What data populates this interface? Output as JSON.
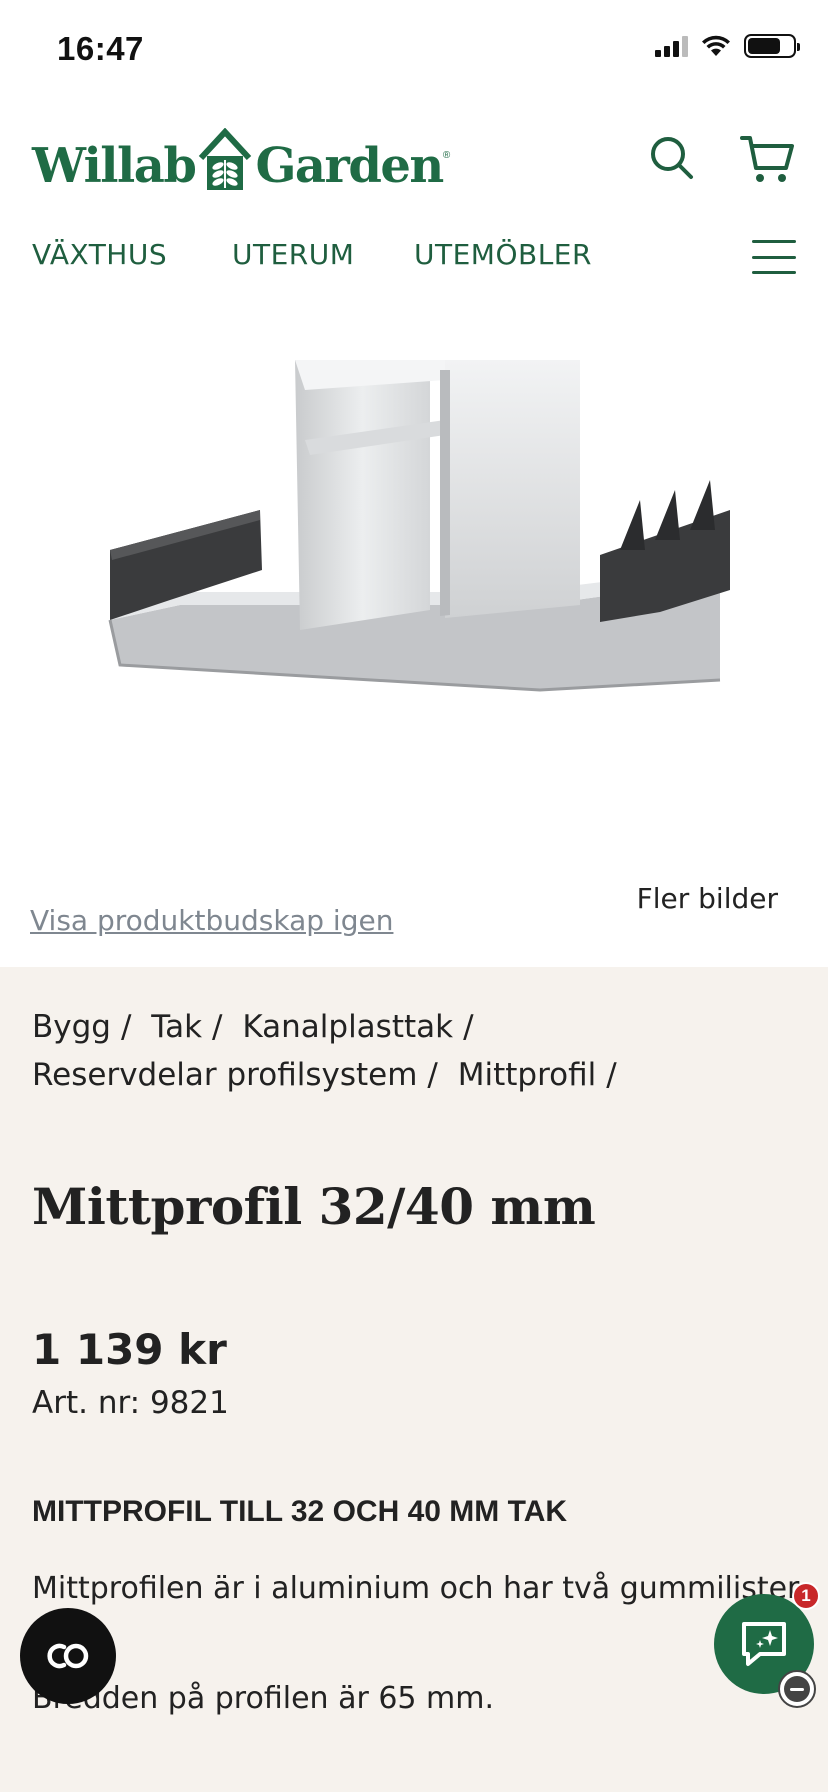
{
  "status_bar": {
    "time": "16:47",
    "icons": [
      "cellular-signal-icon",
      "wifi-icon",
      "battery-icon"
    ]
  },
  "header": {
    "logo": {
      "part1": "Willab",
      "part2": "Garden",
      "reg": "®"
    },
    "icons": [
      "search-icon",
      "cart-icon"
    ]
  },
  "nav": {
    "items": [
      {
        "label": "VÄXTHUS"
      },
      {
        "label": "UTERUM"
      },
      {
        "label": "UTEMÖBLER"
      }
    ],
    "menu_icon": "hamburger-menu-icon"
  },
  "gallery": {
    "more_images_label": "Fler bilder",
    "show_message_link": "Visa produktbudskap igen"
  },
  "breadcrumb": {
    "items": [
      {
        "label": "Bygg"
      },
      {
        "label": "Tak"
      },
      {
        "label": "Kanalplasttak"
      },
      {
        "label": "Reservdelar profilsystem"
      },
      {
        "label": "Mittprofil"
      }
    ],
    "separator": "/"
  },
  "product": {
    "title": "Mittprofil 32/40 mm",
    "price": "1 139 kr",
    "article_number": "Art. nr: 9821",
    "description_heading": "MITTPROFIL TILL 32 OCH 40 MM TAK",
    "description_p1": "Mittprofilen är i aluminium och har två gummilister.",
    "description_p2": "Bredden på profilen är 65 mm."
  },
  "floating": {
    "co_button_icon": "co-logo-icon",
    "chat_icon": "chat-assistant-icon",
    "chat_badge": "1",
    "minimize_icon": "minus-circle-icon"
  },
  "colors": {
    "brand_green": "#1f6b45",
    "info_background": "#f6f2ed",
    "badge_red": "#c8282a"
  }
}
